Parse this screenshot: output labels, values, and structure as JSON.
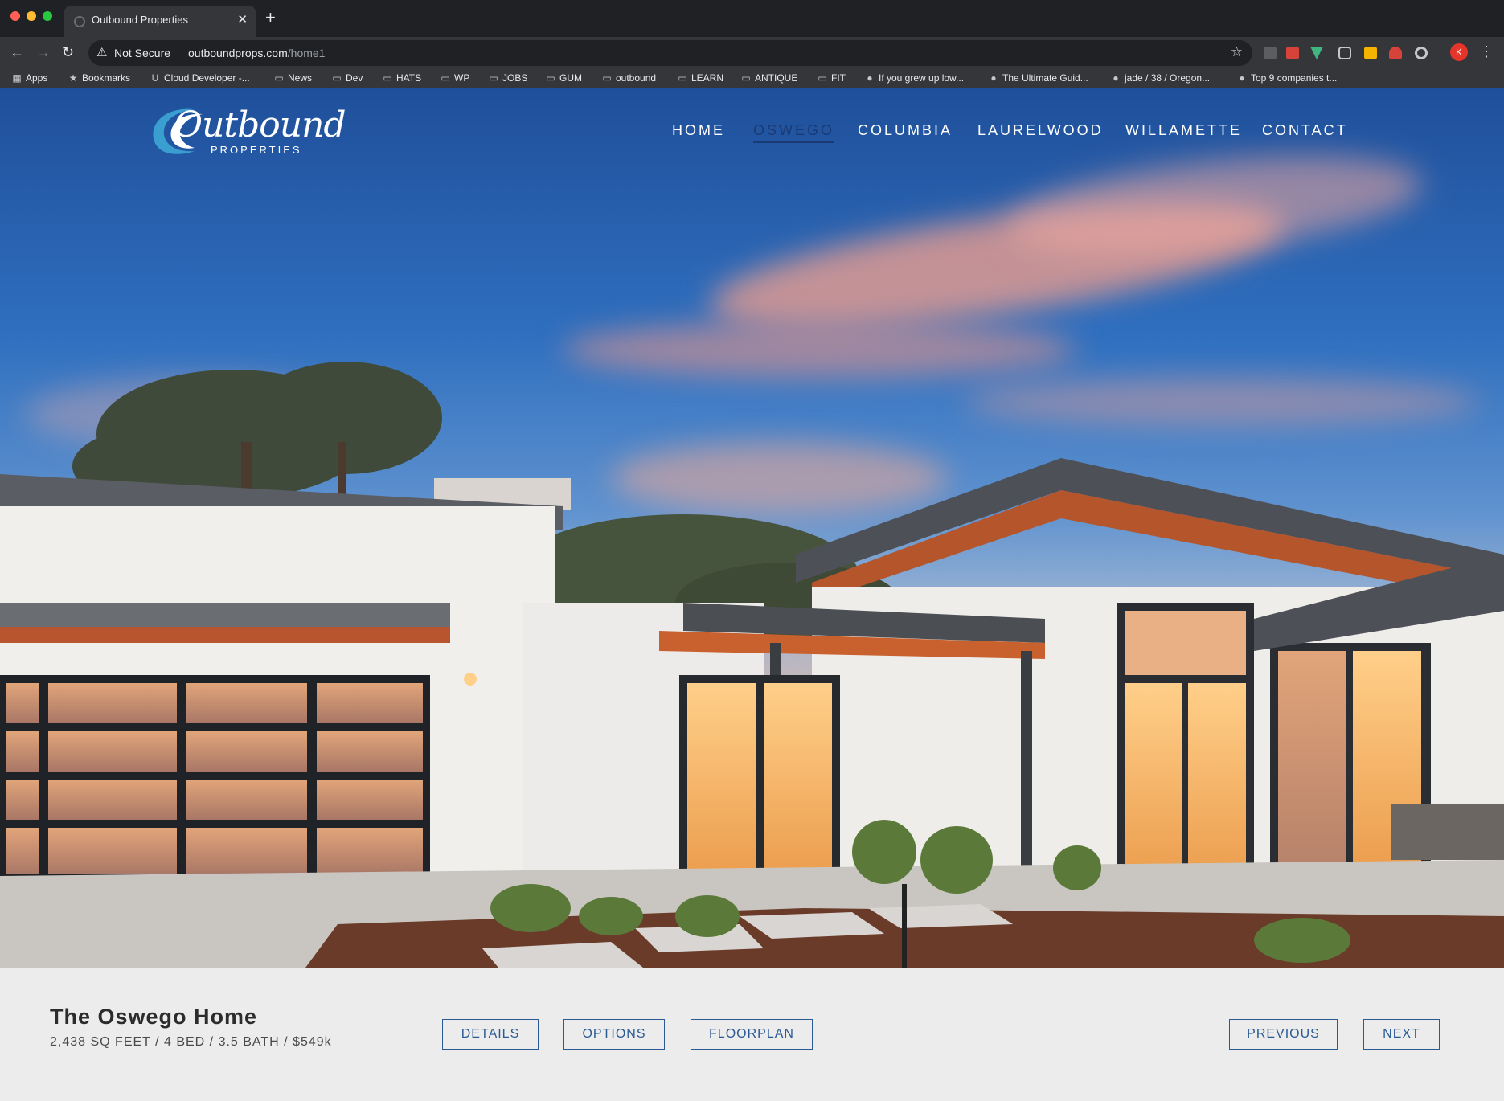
{
  "browser": {
    "tab_title": "Outbound Properties",
    "new_tab_symbol": "+",
    "close_symbol": "✕",
    "security_label": "Not Secure",
    "url_host": "outboundprops.com",
    "url_path": "/home1",
    "profile_initial": "K",
    "bookmarks": [
      {
        "label": "Apps",
        "icon": "apps-grid-icon"
      },
      {
        "label": "Bookmarks",
        "icon": "star-icon"
      },
      {
        "label": "Cloud Developer -...",
        "icon": "cloud-dev-icon"
      },
      {
        "label": "News",
        "icon": "folder-icon"
      },
      {
        "label": "Dev",
        "icon": "folder-icon"
      },
      {
        "label": "HATS",
        "icon": "folder-icon"
      },
      {
        "label": "WP",
        "icon": "folder-icon"
      },
      {
        "label": "JOBS",
        "icon": "folder-icon"
      },
      {
        "label": "GUM",
        "icon": "folder-icon"
      },
      {
        "label": "outbound",
        "icon": "folder-icon"
      },
      {
        "label": "LEARN",
        "icon": "folder-icon"
      },
      {
        "label": "ANTIQUE",
        "icon": "folder-icon"
      },
      {
        "label": "FIT",
        "icon": "folder-icon"
      },
      {
        "label": "If you grew up low...",
        "icon": "site-icon"
      },
      {
        "label": "The Ultimate Guid...",
        "icon": "site-icon"
      },
      {
        "label": "jade / 38 / Oregon...",
        "icon": "site-icon"
      },
      {
        "label": "Top 9 companies t...",
        "icon": "site-icon"
      }
    ]
  },
  "site": {
    "logo_text": "Outbound",
    "logo_sub": "PROPERTIES",
    "nav": [
      "HOME",
      "OSWEGO",
      "COLUMBIA",
      "LAURELWOOD",
      "WILLAMETTE",
      "CONTACT"
    ],
    "active_nav": "OSWEGO"
  },
  "listing": {
    "title": "The Oswego Home",
    "summary": "2,438 SQ FEET / 4 BED / 3.5 BATH / $549k",
    "buttons": {
      "details": "DETAILS",
      "options": "OPTIONS",
      "floorplan": "FLOORPLAN",
      "previous": "PREVIOUS",
      "next": "NEXT"
    }
  },
  "colors": {
    "accent": "#2a5a94",
    "nav_active": "#1a3a75",
    "footer_bg": "#ececec"
  }
}
